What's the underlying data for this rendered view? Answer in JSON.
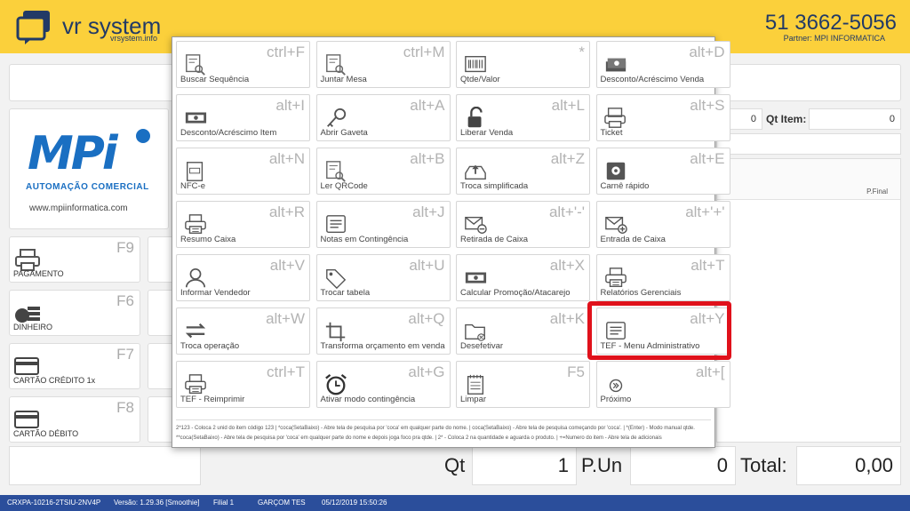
{
  "header": {
    "brand": "vr system",
    "brand_sub": "vrsystem.info",
    "phone": "51 3662-5056",
    "partner": "Partner: MPI INFORMATICA"
  },
  "logo": {
    "name": "MPi",
    "tagline": "AUTOMAÇÃO COMERCIAL",
    "url": "www.mpiinformatica.com"
  },
  "fkeys": [
    {
      "key": "F9",
      "label": "PAGAMENTO",
      "icon": "printer-icon"
    },
    {
      "key": "F6",
      "label": "DINHEIRO",
      "icon": "cash-icon"
    },
    {
      "key": "F7",
      "label": "CARTÃO CRÉDITO 1x",
      "icon": "credit-card-icon"
    },
    {
      "key": "F8",
      "label": "CARTÃO DÉBITO",
      "icon": "debit-card-icon"
    }
  ],
  "info": {
    "qt_item_label": "Qt Item:",
    "qt_item_value": "0",
    "left_value": "0",
    "pfinal": "P.Final"
  },
  "shortcuts": [
    {
      "key": "ctrl+F",
      "label": "Buscar Sequência",
      "icon": "doc-search-icon"
    },
    {
      "key": "ctrl+M",
      "label": "Juntar Mesa",
      "icon": "doc-search-icon"
    },
    {
      "key": "*",
      "label": "Qtde/Valor",
      "icon": "barcode-icon"
    },
    {
      "key": "alt+D",
      "label": "Desconto/Acréscimo Venda",
      "icon": "money-stack-icon"
    },
    {
      "key": "alt+I",
      "label": "Desconto/Acréscimo Item",
      "icon": "money-icon"
    },
    {
      "key": "alt+A",
      "label": "Abrir Gaveta",
      "icon": "key-icon"
    },
    {
      "key": "alt+L",
      "label": "Liberar Venda",
      "icon": "unlock-icon"
    },
    {
      "key": "alt+S",
      "label": "Ticket",
      "icon": "ticket-printer-icon"
    },
    {
      "key": "alt+N",
      "label": "NFC-e",
      "icon": "nfce-icon"
    },
    {
      "key": "alt+B",
      "label": "Ler QRCode",
      "icon": "doc-search-icon"
    },
    {
      "key": "alt+Z",
      "label": "Troca simplificada",
      "icon": "tray-up-icon"
    },
    {
      "key": "alt+E",
      "label": "Carnê rápido",
      "icon": "safe-icon"
    },
    {
      "key": "alt+R",
      "label": "Resumo Caixa",
      "icon": "printer-icon"
    },
    {
      "key": "alt+J",
      "label": "Notas em Contingência",
      "icon": "list-doc-icon"
    },
    {
      "key": "alt+'-'",
      "label": "Retirada de Caixa",
      "icon": "mail-minus-icon"
    },
    {
      "key": "alt+'+'",
      "label": "Entrada de Caixa",
      "icon": "mail-plus-icon"
    },
    {
      "key": "alt+V",
      "label": "Informar Vendedor",
      "icon": "user-icon"
    },
    {
      "key": "alt+U",
      "label": "Trocar tabela",
      "icon": "tag-icon"
    },
    {
      "key": "alt+X",
      "label": "Calcular Promoção/Atacarejo",
      "icon": "money-icon"
    },
    {
      "key": "alt+T",
      "label": "Relatórios Gerenciais",
      "icon": "printer-icon"
    },
    {
      "key": "alt+W",
      "label": "Troca operação",
      "icon": "swap-icon"
    },
    {
      "key": "alt+Q",
      "label": "Transforma orçamento em venda",
      "icon": "crop-icon"
    },
    {
      "key": "alt+K",
      "label": "Desefetivar",
      "icon": "folder-x-icon"
    },
    {
      "key": "alt+Y",
      "label": "TEF - Menu Administrativo",
      "icon": "list-doc-icon"
    },
    {
      "key": "ctrl+T",
      "label": "TEF - Reimprimir",
      "icon": "printer-icon"
    },
    {
      "key": "alt+G",
      "label": "Ativar modo contingência",
      "icon": "alarm-clock-icon"
    },
    {
      "key": "F5",
      "label": "Limpar",
      "icon": "notepad-icon"
    },
    {
      "key": "alt+[",
      "label": "Próximo",
      "icon": "next-icon"
    }
  ],
  "help": {
    "line1": "2*123 - Coloca 2 unid do item código 123 | *coca(SetaBaixo) - Abre tela de pesquisa por 'coca' em qualquer parte do nome. | coca(SetaBaixo) - Abre tela de pesquisa começando por 'coca'. | *(Enter) - Modo manual qtde.",
    "line2": "**coca(SetaBaixo) - Abre tela de pesquisa por 'coca' em qualquer parte do nome e depois joga foco pra qtde. | 2* - Coloca 2 na quantidade e aguarda o produto. | +=Numero do item - Abre tela de adicionais"
  },
  "totals": {
    "qt_label": "Qt",
    "qt_value": "1",
    "pun_label": "P.Un",
    "pun_value": "0",
    "total_label": "Total:",
    "total_value": "0,00"
  },
  "status": {
    "terminal": "CRXPA-10216-2TSIU-2NV4P",
    "version": "Versão: 1.29.36 [Smoothie]",
    "branch": "Filial 1",
    "user": "GARÇOM TES",
    "datetime": "05/12/2019 15:50:26"
  },
  "colors": {
    "header": "#fbd03b",
    "brand": "#223a66",
    "status_bar": "#2b4e9b",
    "highlight": "#e0111b"
  }
}
